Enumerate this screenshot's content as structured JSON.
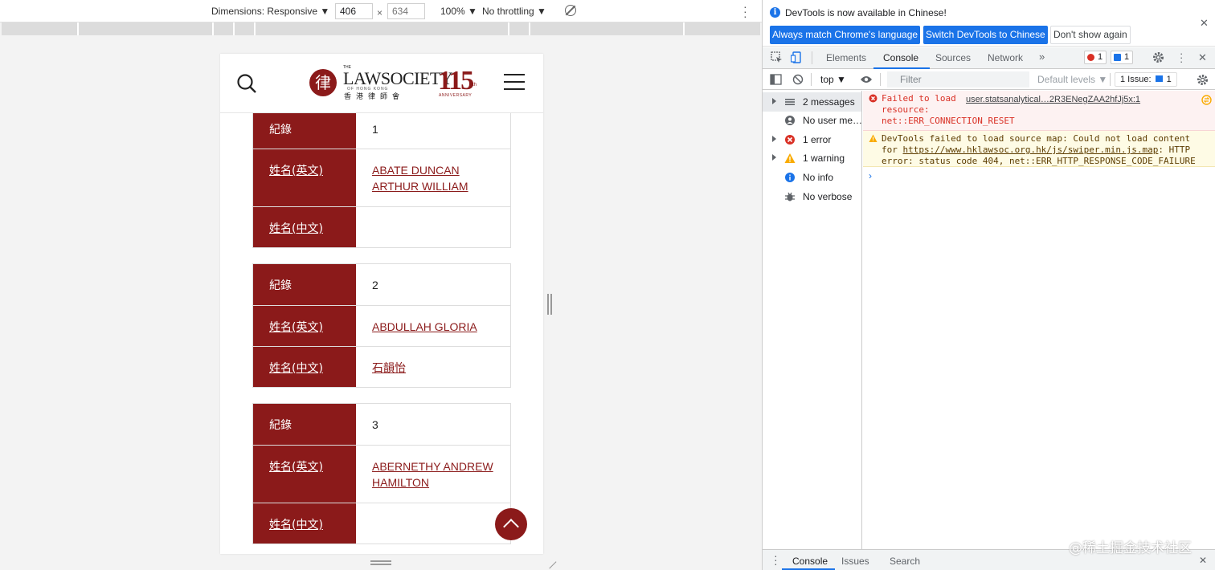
{
  "emulation_toolbar": {
    "dimensions_label": "Dimensions: Responsive ▼",
    "width": "406",
    "height_placeholder": "634",
    "times": "×",
    "zoom": "100% ▼",
    "throttling": "No throttling ▼"
  },
  "site": {
    "logo": {
      "the": "THE",
      "name": "LAWSOCIETY",
      "sub": "OF HONG KONG",
      "chinese": "香港律師會",
      "number": "115",
      "ordinal": "th",
      "anniversary": "ANNIVERSARY"
    },
    "records": [
      {
        "label_record": "紀錄",
        "record": "1",
        "label_en": "姓名(英文)",
        "name_en": "ABATE DUNCAN ARTHUR WILLIAM",
        "label_cn": "姓名(中文)",
        "name_cn": ""
      },
      {
        "label_record": "紀錄",
        "record": "2",
        "label_en": "姓名(英文)",
        "name_en": "ABDULLAH GLORIA",
        "label_cn": "姓名(中文)",
        "name_cn": "石韻怡"
      },
      {
        "label_record": "紀錄",
        "record": "3",
        "label_en": "姓名(英文)",
        "name_en": "ABERNETHY ANDREW HAMILTON",
        "label_cn": "姓名(中文)",
        "name_cn": ""
      }
    ],
    "colors": {
      "brand": "#8b1a1a"
    }
  },
  "devtools": {
    "infobar": {
      "message": "DevTools is now available in Chinese!",
      "btn_match": "Always match Chrome's language",
      "btn_switch": "Switch DevTools to Chinese",
      "btn_dismiss": "Don't show again"
    },
    "tabs": [
      "Elements",
      "Console",
      "Sources",
      "Network"
    ],
    "more_tabs": "»",
    "error_count": "1",
    "issue_count": "1",
    "filterbar": {
      "context": "top ▼",
      "filter_placeholder": "Filter",
      "levels": "Default levels ▼",
      "issues": "1 Issue:",
      "issues_count": "1"
    },
    "sidebar": [
      {
        "label": "2 messages",
        "icon": "list-icon",
        "expandable": true
      },
      {
        "label": "No user me…",
        "icon": "user-icon",
        "expandable": false
      },
      {
        "label": "1 error",
        "icon": "error-icon",
        "expandable": true
      },
      {
        "label": "1 warning",
        "icon": "warning-icon",
        "expandable": true
      },
      {
        "label": "No info",
        "icon": "info-icon",
        "expandable": false
      },
      {
        "label": "No verbose",
        "icon": "bug-icon",
        "expandable": false
      }
    ],
    "messages": {
      "error": {
        "line1": "Failed to load",
        "line2": "resource:",
        "line3": "net::ERR_CONNECTION_RESET",
        "source": "user.statsanalytical…2R3ENegZAA2hfJj5x:1"
      },
      "warning": {
        "line1": "DevTools failed to load source map: Could not load content",
        "line2_prefix": "for ",
        "line2_link": "https://www.hklawsoc.org.hk/js/swiper.min.js.map",
        "line2_suffix": ": HTTP",
        "line3": "error: status code 404, net::ERR_HTTP_RESPONSE_CODE_FAILURE"
      }
    },
    "prompt": "›",
    "drawer_tabs": [
      "Console",
      "Issues",
      "Search"
    ],
    "close": "✕"
  },
  "watermark": "@稀土掘金技术社区"
}
